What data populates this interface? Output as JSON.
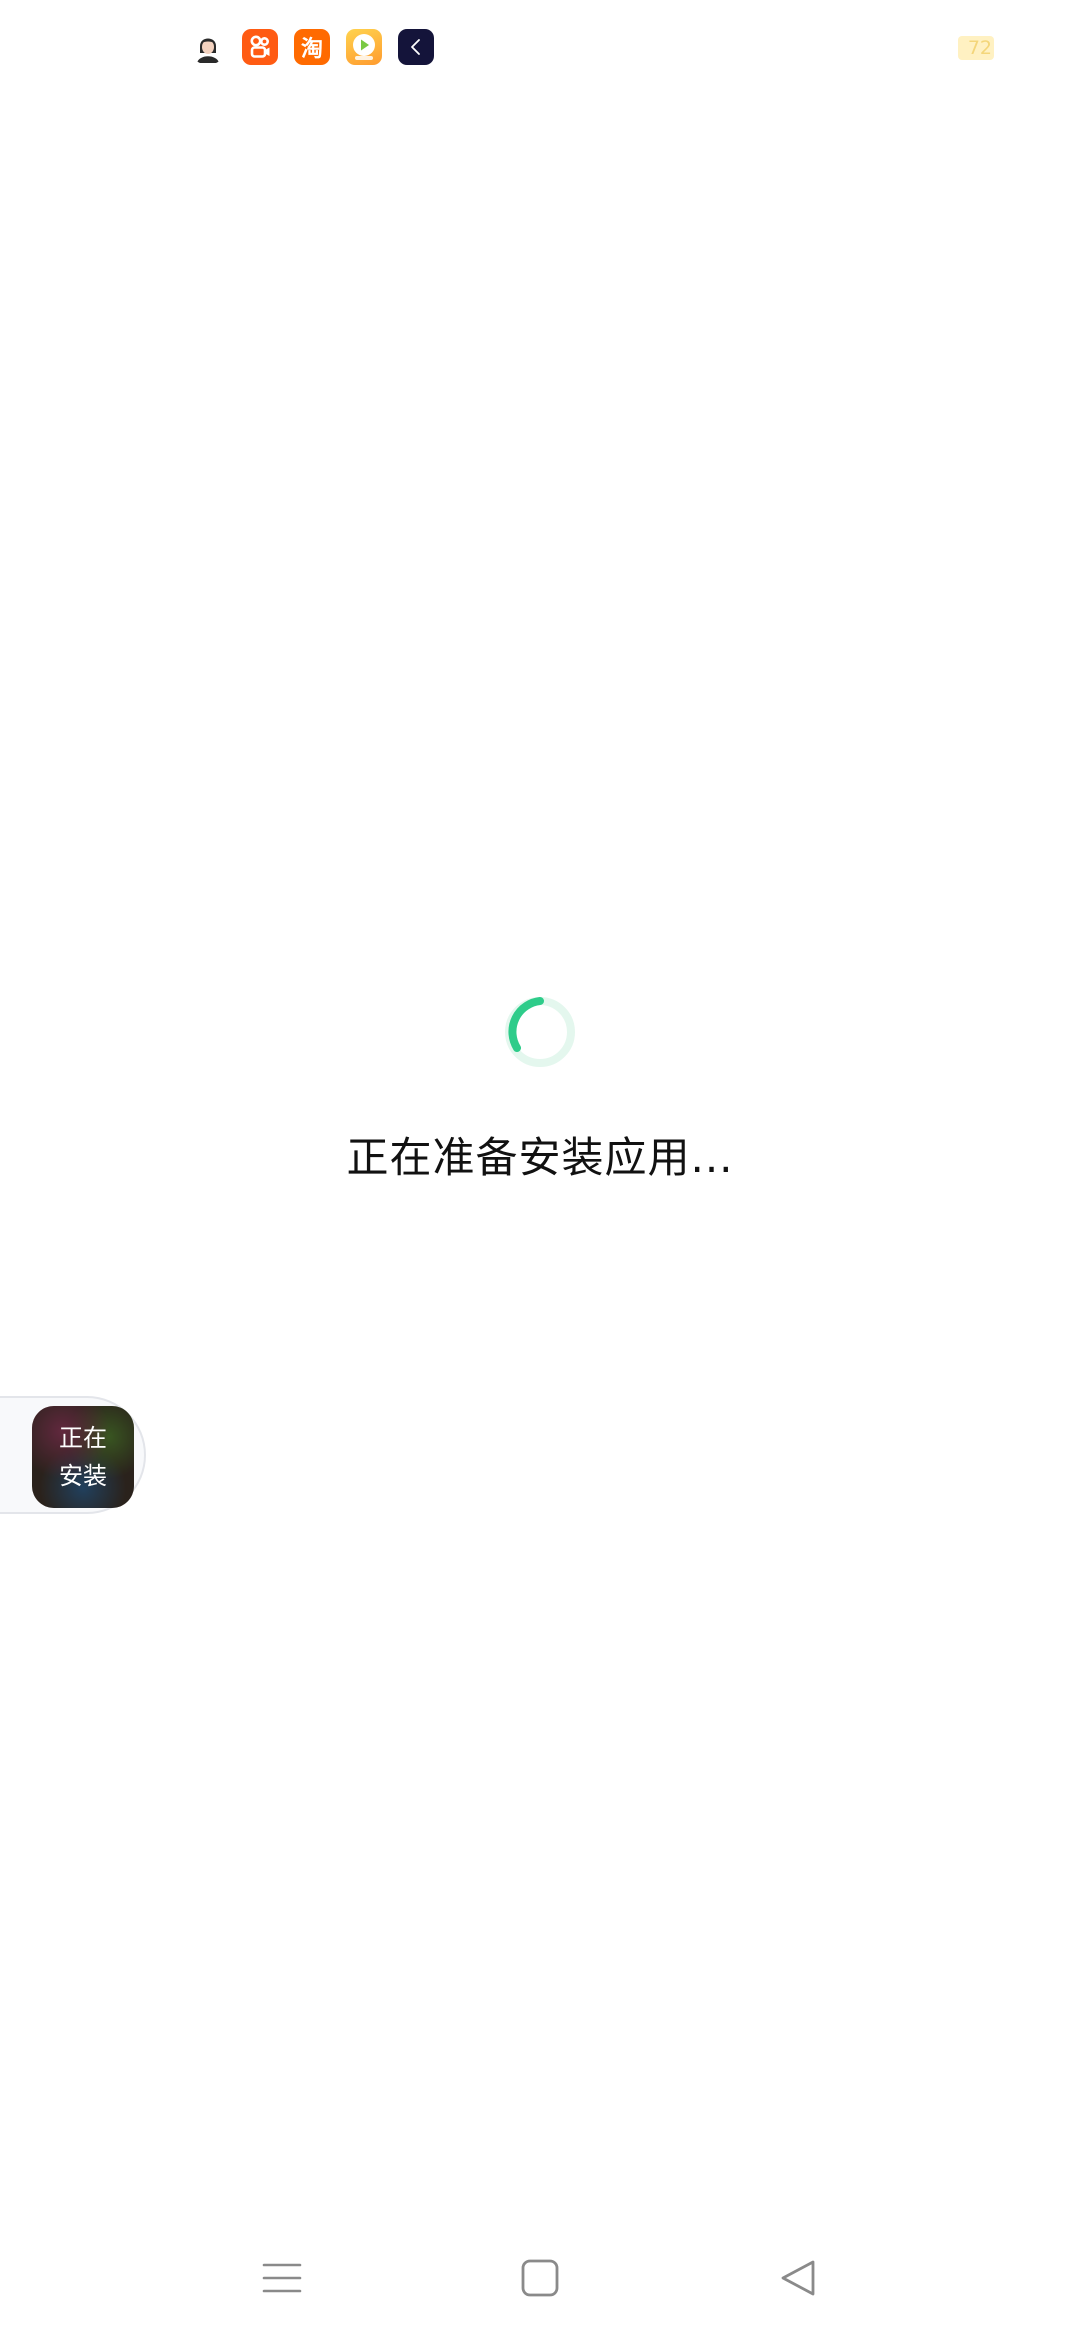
{
  "status_bar": {
    "notification_icons": [
      "avatar-icon",
      "kuaishou-icon",
      "taobao-icon",
      "video-player-icon",
      "dark-app-icon"
    ],
    "taobao_glyph": "淘",
    "battery_level": "72"
  },
  "main": {
    "spinner": {
      "accent_color": "#2ecc8a",
      "track_color": "#e4f7ee"
    },
    "loading_text": "正在准备安装应用..."
  },
  "install_float": {
    "line1": "正在",
    "line2": "安装"
  },
  "nav_bar": {
    "buttons": [
      "menu-icon",
      "home-icon",
      "back-icon"
    ]
  }
}
